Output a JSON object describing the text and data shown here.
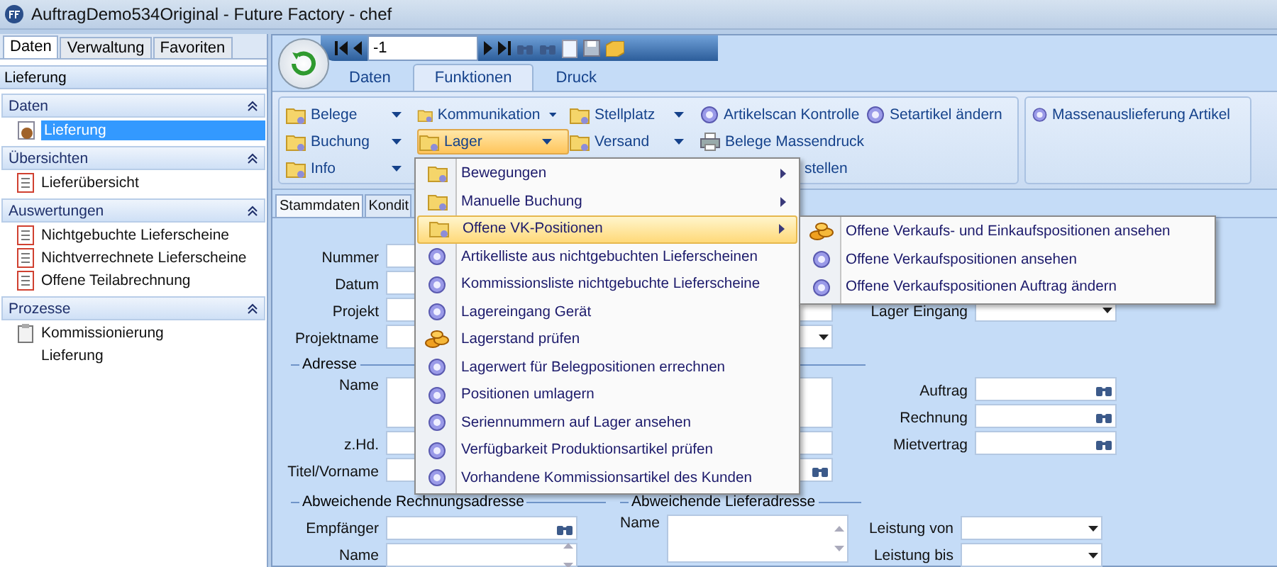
{
  "window": {
    "title": "AuftragDemo534Original - Future Factory - chef"
  },
  "sidebar": {
    "tabs": [
      {
        "label": "Daten",
        "selected": true
      },
      {
        "label": "Verwaltung",
        "selected": false
      },
      {
        "label": "Favoriten",
        "selected": false
      }
    ],
    "header": "Lieferung",
    "sections": [
      {
        "title": "Daten",
        "items": [
          {
            "label": "Lieferung",
            "kind": "box",
            "selected": true
          }
        ]
      },
      {
        "title": "Übersichten",
        "items": [
          {
            "label": "Lieferübersicht",
            "kind": "report",
            "selected": false
          }
        ]
      },
      {
        "title": "Auswertungen",
        "items": [
          {
            "label": "Nichtgebuchte Lieferscheine",
            "kind": "report",
            "selected": false
          },
          {
            "label": "Nichtverrechnete Lieferscheine",
            "kind": "report",
            "selected": false
          },
          {
            "label": "Offene Teilabrechnung",
            "kind": "report",
            "selected": false
          }
        ]
      },
      {
        "title": "Prozesse",
        "items": [
          {
            "label": "Kommissionierung",
            "kind": "clipboard",
            "selected": false
          },
          {
            "label": "Lieferung",
            "kind": "blank",
            "selected": false
          }
        ]
      }
    ]
  },
  "toolbar": {
    "record": "-1"
  },
  "ribbon": {
    "tabs": [
      {
        "label": "Daten",
        "selected": false
      },
      {
        "label": "Funktionen",
        "selected": true
      },
      {
        "label": "Druck",
        "selected": false
      }
    ],
    "groups": [
      {
        "rows": [
          [
            {
              "label": "Belege",
              "kind": "split",
              "active": false
            },
            {
              "label": "Kommunikation",
              "kind": "split",
              "active": false
            },
            {
              "label": "Stellplatz",
              "kind": "split",
              "active": false
            },
            {
              "label": "Artikelscan Kontrolle",
              "kind": "action",
              "active": false
            },
            {
              "label": "Setartikel ändern",
              "kind": "action",
              "active": false
            }
          ],
          [
            {
              "label": "Buchung",
              "kind": "split",
              "active": false
            },
            {
              "label": "Lager",
              "kind": "split",
              "active": true
            },
            {
              "label": "Versand",
              "kind": "split",
              "active": false
            },
            {
              "label": "Belege Massendruck",
              "kind": "print",
              "active": false
            }
          ],
          [
            {
              "label": "Info",
              "kind": "split",
              "active": false
            },
            "",
            "",
            {
              "label": "stellen",
              "kind": "partial",
              "active": false
            }
          ]
        ]
      },
      {
        "rows": [
          [
            {
              "label": "Massenauslieferung Artikel",
              "kind": "action",
              "active": false
            }
          ]
        ]
      }
    ]
  },
  "menu": {
    "items": [
      {
        "label": "Bewegungen",
        "kind": "submenu",
        "selected": false
      },
      {
        "label": "Manuelle Buchung",
        "kind": "submenu",
        "selected": false
      },
      {
        "label": "Offene VK-Positionen",
        "kind": "submenu",
        "selected": true
      },
      {
        "label": "Artikelliste aus nichtgebuchten Lieferscheinen",
        "kind": "action",
        "selected": false
      },
      {
        "label": "Kommissionsliste nichtgebuchte Lieferscheine",
        "kind": "action",
        "selected": false
      },
      {
        "label": "Lagereingang Gerät",
        "kind": "action",
        "selected": false
      },
      {
        "label": "Lagerstand prüfen",
        "kind": "stock",
        "selected": false
      },
      {
        "label": "Lagerwert für Belegpositionen errechnen",
        "kind": "action",
        "selected": false
      },
      {
        "label": "Positionen umlagern",
        "kind": "action",
        "selected": false
      },
      {
        "label": "Seriennummern auf Lager ansehen",
        "kind": "action",
        "selected": false
      },
      {
        "label": "Verfügbarkeit Produktionsartikel prüfen",
        "kind": "action",
        "selected": false
      },
      {
        "label": "Vorhandene Kommissionsartikel des Kunden",
        "kind": "action",
        "selected": false
      }
    ]
  },
  "submenu": {
    "items": [
      {
        "label": "Offene Verkaufs- und Einkaufspositionen ansehen",
        "kind": "stock"
      },
      {
        "label": "Offene Verkaufspositionen ansehen",
        "kind": "action"
      },
      {
        "label": "Offene Verkaufspositionen Auftrag ändern",
        "kind": "action"
      }
    ]
  },
  "form": {
    "tabs": [
      {
        "label": "Stammdaten",
        "selected": true
      },
      {
        "label": "Kondit",
        "selected": false
      }
    ],
    "main_fields": [
      {
        "label": "Nummer",
        "kind": "text"
      },
      {
        "label": "Datum",
        "kind": "text"
      },
      {
        "label": "Projekt",
        "kind": "text"
      },
      {
        "label": "Projektname",
        "kind": "dropdown"
      }
    ],
    "lager_field": {
      "label": "Lager Eingang",
      "kind": "dropdown"
    },
    "address": {
      "title": "Adresse",
      "fields": [
        {
          "label": "Name",
          "kind": "memo"
        },
        {
          "label": "z.Hd.",
          "kind": "text"
        },
        {
          "label": "Titel/Vorname",
          "kind": "lookup"
        }
      ]
    },
    "references": [
      {
        "label": "Auftrag",
        "kind": "lookup"
      },
      {
        "label": "Rechnung",
        "kind": "lookup"
      },
      {
        "label": "Mietvertrag",
        "kind": "lookup"
      }
    ],
    "billing": {
      "title": "Abweichende Rechnungsadresse",
      "fields": [
        {
          "label": "Empfänger",
          "kind": "lookup"
        },
        {
          "label": "Name",
          "kind": "memo"
        }
      ]
    },
    "delivery": {
      "title": "Abweichende Lieferadresse",
      "fields": [
        {
          "label": "Name",
          "kind": "memo"
        }
      ]
    },
    "service": [
      {
        "label": "Leistung von",
        "kind": "dropdown"
      },
      {
        "label": "Leistung bis",
        "kind": "dropdown"
      }
    ]
  }
}
